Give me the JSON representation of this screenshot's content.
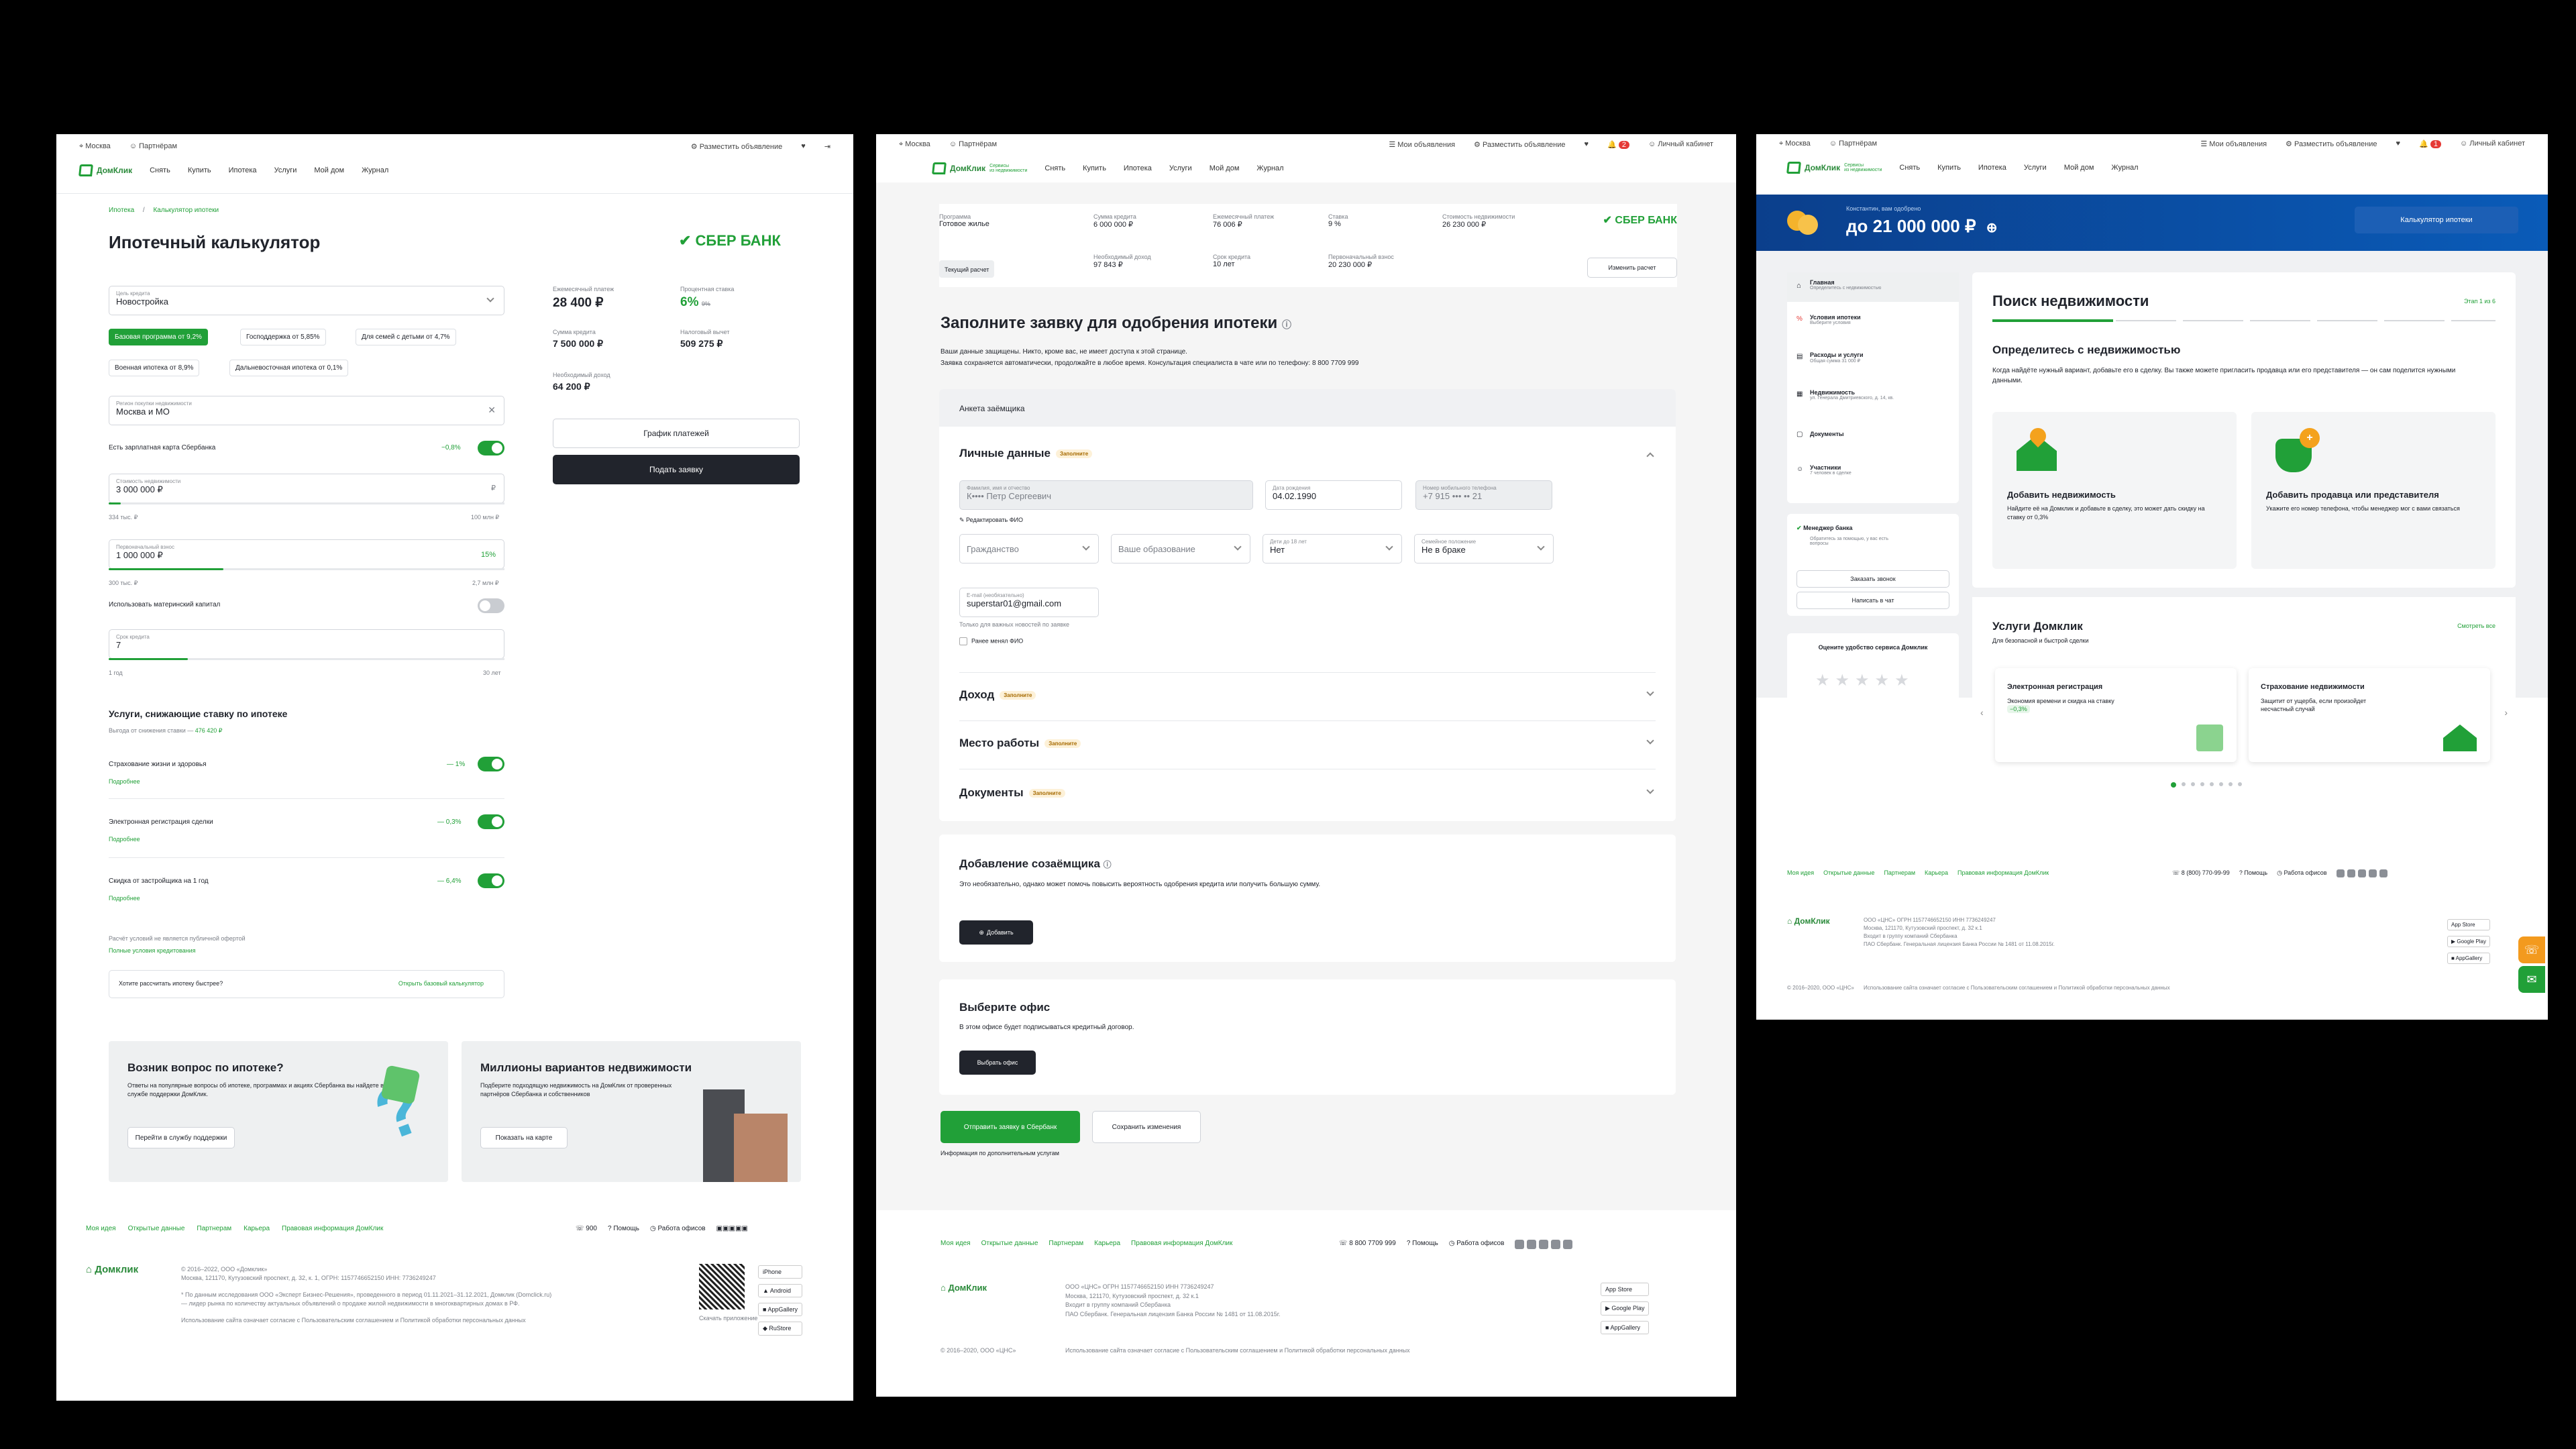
{
  "p1": {
    "topbar": {
      "city": "Москва",
      "partners": "Партнёрам",
      "post_ad": "Разместить объявление"
    },
    "logo": "ДомКлик",
    "nav": [
      "Снять",
      "Купить",
      "Ипотека",
      "Услуги",
      "Мой дом",
      "Журнал"
    ],
    "breadcrumb": [
      "Ипотека",
      "Калькулятор ипотеки"
    ],
    "title": "Ипотечный калькулятор",
    "bank": "СБЕР БАНК",
    "goal": {
      "label": "Цель кредита",
      "value": "Новостройка"
    },
    "programs": [
      "Базовая программа от 9,2%",
      "Господдержка от 5,85%",
      "Для семей с детьми от 4,7%",
      "Военная ипотека от 8,9%",
      "Дальневосточная ипотека от 0,1%"
    ],
    "region": {
      "label": "Регион покупки недвижимости",
      "value": "Москва и МО"
    },
    "salary": {
      "label": "Есть зарплатная карта Сбербанка",
      "value": "−0,8%"
    },
    "price": {
      "label": "Стоимость недвижимости",
      "value": "3 000 000 ₽",
      "min": "334 тыс. ₽",
      "max": "100 млн ₽",
      "fill": 0.03
    },
    "down": {
      "label": "Первоначальный взнос",
      "value": "1 000 000 ₽",
      "pct": "15%",
      "min": "300 тыс. ₽",
      "max": "2,7 млн ₽",
      "fill": 0.29
    },
    "matcap": "Использовать материнский капитал",
    "term": {
      "label": "Срок кредита",
      "value": "7",
      "min": "1 год",
      "max": "30 лет",
      "fill": 0.2
    },
    "summary": {
      "monthly_label": "Ежемесячный платеж",
      "monthly": "28 400 ₽",
      "rate_label": "Процентная ставка",
      "rate": "6%",
      "rate_old": "9%",
      "loan_label": "Сумма кредита",
      "loan": "7 500 000 ₽",
      "tax_label": "Налоговый вычет",
      "tax": "509 275 ₽",
      "income_label": "Необходимый доход",
      "income": "64 200 ₽"
    },
    "schedule_btn": "График платежей",
    "apply_btn": "Подать заявку",
    "services": {
      "title": "Услуги, снижающие ставку по ипотеке",
      "benefit_label": "Выгода от снижения ставки —",
      "benefit": "476 420 ₽",
      "items": [
        {
          "name": "Страхование жизни и здоровья",
          "value": "— 1%",
          "more": "Подробнее"
        },
        {
          "name": "Электронная регистрация сделки",
          "value": "— 0,3%",
          "more": "Подробнее"
        },
        {
          "name": "Скидка от застройщика на 1 год",
          "value": "— 6,4%",
          "more": "Подробнее"
        }
      ]
    },
    "disclaimer": "Расчёт условий не является публичной офертой",
    "full_terms": "Полные условия кредитования",
    "quick": {
      "text": "Хотите рассчитать ипотеку быстрее?",
      "link": "Открыть базовый калькулятор"
    },
    "promo1": {
      "title": "Возник вопрос по ипотеке?",
      "text": "Ответы на популярные вопросы об ипотеке, программах и акциях Сбербанка вы найдете в службе поддержки ДомКлик.",
      "btn": "Перейти в службу поддержки"
    },
    "promo2": {
      "title": "Миллионы вариантов недвижимости",
      "text": "Подберите подходящую недвижимость на ДомКлик от проверенных партнёров Сбербанка и собственников",
      "btn": "Показать на карте"
    },
    "footer": {
      "links": [
        "Моя идея",
        "Открытые данные",
        "Партнерам",
        "Карьера",
        "Правовая информация ДомКлик"
      ],
      "phone": "900",
      "help": "Помощь",
      "offices": "Работа офисов",
      "logo": "Домклик",
      "copyright": "© 2016–2022, ООО «Домклик»",
      "address": "Москва, 121170, Кутузовский проспект, д. 32, к. 1, ОГРН: 1157746652150 ИНН: 7736249247",
      "note": "* По данным исследования ООО «Эксперт Бизнес-Решения», проведенного в период 01.11.2021–31.12.2021, Домклик (Domclick.ru) — лидер рынка по количеству актуальных объявлений о продаже жилой недвижимости в многоквартирных домах в РФ.",
      "agree": "Использование сайта означает согласие с Пользовательским соглашением и Политикой обработки персональных данных",
      "qr_caption": "Скачать приложение",
      "stores": [
        "iPhone",
        "Android",
        "AppGallery",
        "RuStore"
      ]
    }
  },
  "p2": {
    "topbar": {
      "city": "Москва",
      "partners": "Партнёрам",
      "my_ads": "Мои объявления",
      "post_ad": "Разместить объявление",
      "badge": "2",
      "cabinet": "Личный кабинет"
    },
    "logo": "ДомКлик",
    "logo_sub": "Сервисы\nиз недвижимости",
    "nav": [
      "Снять",
      "Купить",
      "Ипотека",
      "Услуги",
      "Мой дом",
      "Журнал"
    ],
    "summary": [
      {
        "label": "Программа",
        "value": "Готовое жилье"
      },
      {
        "label": "Сумма кредита",
        "value": "6 000 000 ₽"
      },
      {
        "label": "Ежемесячный платеж",
        "value": "76 006 ₽"
      },
      {
        "label": "Ставка",
        "value": "9 %"
      },
      {
        "label": "Стоимость недвижимости",
        "value": "26 230 000 ₽"
      },
      {
        "label": "Необходимый доход",
        "value": "97 843 ₽"
      },
      {
        "label": "Срок кредита",
        "value": "10 лет"
      },
      {
        "label": "Первоначальный взнос",
        "value": "20 230 000 ₽"
      }
    ],
    "bank": "СБЕР БАНК",
    "current_calc": "Текущий расчет",
    "change_calc": "Изменить расчет",
    "title": "Заполните заявку для одобрения ипотеки",
    "subtitle1": "Ваши данные защищены. Никто, кроме вас, не имеет доступа к этой странице.",
    "subtitle2": "Заявка сохраняется автоматически, продолжайте в любое время. Консультация специалиста в чате или по телефону: 8 800 7709 999",
    "form_header": "Анкета заёмщика",
    "personal": {
      "title": "Личные данные",
      "tag": "Заполните"
    },
    "fio": {
      "label": "Фамилия, имя и отчество",
      "value": "К•••• Петр Сергеевич"
    },
    "dob": {
      "label": "Дата рождения",
      "value": "04.02.1990"
    },
    "phone": {
      "label": "Номер мобильного телефона",
      "value": "+7 915 ••• •• 21"
    },
    "edit_fio": "Редактировать ФИО",
    "citizenship": "Гражданство",
    "education": "Ваше образование",
    "kids": {
      "label": "Дети до 18 лет",
      "value": "Нет"
    },
    "marital": {
      "label": "Семейное положение",
      "value": "Не в браке"
    },
    "email": {
      "label": "E-mail (необязательно)",
      "value": "superstar01@gmail.com"
    },
    "email_note": "Только для важных новостей по заявке",
    "changed_fio": "Ранее менял ФИО",
    "sections": [
      {
        "title": "Доход",
        "tag": "Заполните"
      },
      {
        "title": "Место работы",
        "tag": "Заполните"
      },
      {
        "title": "Документы",
        "tag": "Заполните"
      }
    ],
    "coborrower": {
      "title": "Добавление созаёмщика",
      "text": "Это необязательно, однако может помочь повысить вероятность одобрения кредита или получить большую сумму.",
      "btn": "Добавить"
    },
    "office": {
      "title": "Выберите офис",
      "text": "В этом офисе будет подписываться кредитный договор.",
      "btn": "Выбрать офис"
    },
    "send_btn": "Отправить заявку в Сбербанк",
    "save_btn": "Сохранить изменения",
    "extra": "Информация по дополнительным услугам",
    "footer": {
      "links": [
        "Моя идея",
        "Открытые данные",
        "Партнерам",
        "Карьера",
        "Правовая информация ДомКлик"
      ],
      "phone": "8 800 7709 999",
      "help": "Помощь",
      "offices": "Работа офисов",
      "logo": "ДомКлик",
      "legal": [
        "ООО «ЦНС» ОГРН 1157746652150 ИНН 7736249247",
        "Москва, 121170, Кутузовский проспект, д. 32 к.1",
        "Входит в группу компаний Сбербанка",
        "ПАО Сбербанк. Генеральная лицензия Банка России № 1481 от 11.08.2015г."
      ],
      "copyright": "© 2016–2020, ООО «ЦНС»",
      "agree": "Использование сайта означает согласие с Пользовательским соглашением и Политикой обработки персональных данных",
      "stores": [
        "App Store",
        "Google Play",
        "AppGallery"
      ]
    }
  },
  "p3": {
    "topbar": {
      "city": "Москва",
      "partners": "Партнёрам",
      "my_ads": "Мои объявления",
      "post_ad": "Разместить объявление",
      "badge": "1",
      "cabinet": "Личный кабинет"
    },
    "logo": "ДомКлик",
    "logo_sub": "Сервисы\nиз недвижимости",
    "nav": [
      "Снять",
      "Купить",
      "Ипотека",
      "Услуги",
      "Мой дом",
      "Журнал"
    ],
    "banner": {
      "greeting": "Константин, вам одобрено",
      "amount": "до 21 000 000 ₽",
      "btn": "Калькулятор ипотеки"
    },
    "sidebar": [
      {
        "title": "Главная",
        "sub": "Определитесь с недвижимостью"
      },
      {
        "title": "Условия ипотеки",
        "sub": "Выберите условия"
      },
      {
        "title": "Расходы и услуги",
        "sub": "Общая сумма 31 000 ₽"
      },
      {
        "title": "Недвижимость",
        "sub": "ул. Генерала Дмитриевского, д. 14, кв."
      },
      {
        "title": "Документы",
        "sub": ""
      },
      {
        "title": "Участники",
        "sub": "7 человек в сделке"
      }
    ],
    "manager": {
      "title": "Менеджер банка",
      "text": "Обратитесь за помощью, у вас есть вопросы",
      "call_btn": "Заказать звонок",
      "chat_btn": "Написать в чат"
    },
    "rate": {
      "title": "Оцените удобство сервиса Домклик"
    },
    "search": {
      "title": "Поиск недвижимости",
      "stage": "Этап 1 из 6",
      "sub": "Определитесь с недвижимостью",
      "text": "Когда найдёте нужный вариант, добавьте его в сделку. Вы также можете пригласить продавца или его представителя — он сам поделится нужными данными."
    },
    "option1": {
      "title": "Добавить недвижимость",
      "text": "Найдите её на Домклик и добавьте в сделку, это может дать скидку на ставку от 0,3%"
    },
    "option2": {
      "title": "Добавить продавца или представителя",
      "text": "Укажите его номер телефона, чтобы менеджер мог с вами связаться"
    },
    "services": {
      "title": "Услуги Домклик",
      "sub": "Для безопасной и быстрой сделки",
      "all": "Смотреть все",
      "items": [
        {
          "title": "Электронная регистрация",
          "text": "Экономия времени и скидка на ставку",
          "badge": "−0,3%"
        },
        {
          "title": "Страхование недвижимости",
          "text": "Защитит от ущерба, если произойдет несчастный случай"
        }
      ]
    },
    "footer": {
      "links": [
        "Моя идея",
        "Открытые данные",
        "Партнерам",
        "Карьера",
        "Правовая информация ДомКлик"
      ],
      "phone": "8 (800) 770-99-99",
      "help": "Помощь",
      "offices": "Работа офисов",
      "logo": "ДомКлик",
      "legal": [
        "ООО «ЦНС» ОГРН 1157746652150 ИНН 7736249247",
        "Москва, 121170, Кутузовский проспект, д. 32 к.1",
        "Входит в группу компаний Сбербанка",
        "ПАО Сбербанк. Генеральная лицензия Банка России № 1481 от 11.08.2015г."
      ],
      "copyright": "© 2016–2020, ООО «ЦНС»",
      "agree": "Использование сайта означает согласие с Пользовательским соглашением и Политикой обработки персональных данных",
      "stores": [
        "App Store",
        "Google Play",
        "AppGallery"
      ]
    }
  },
  "colors": {
    "accent": "#21a038",
    "dark": "#21242c",
    "banner": "#0b3f8c"
  }
}
